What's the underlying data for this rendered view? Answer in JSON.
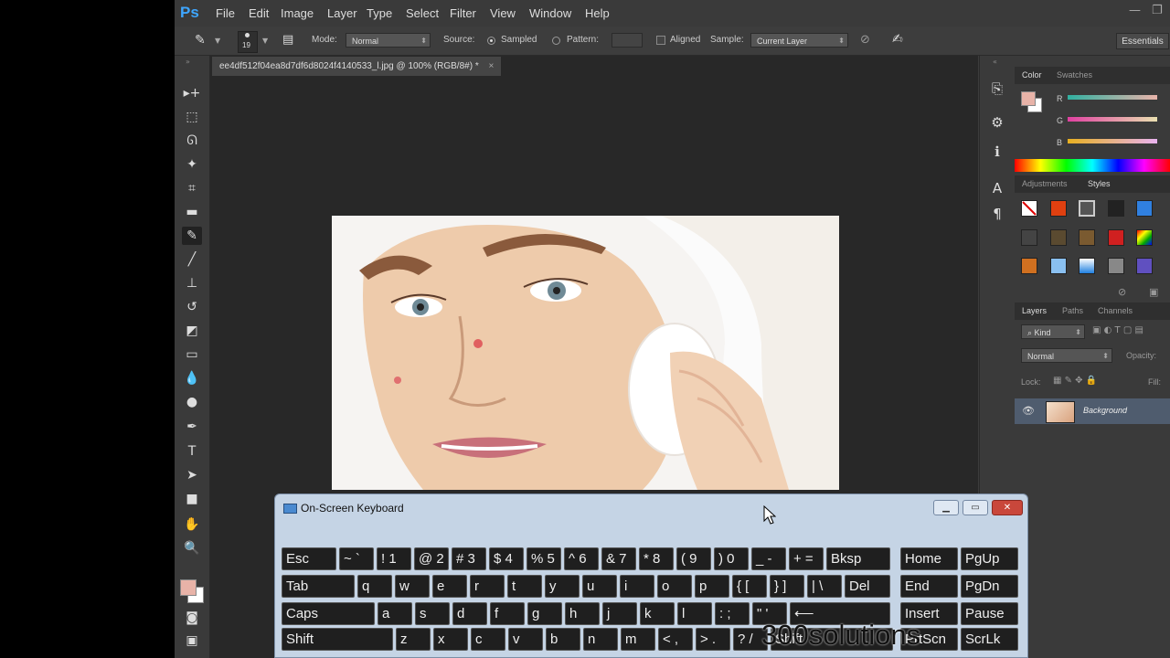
{
  "app": {
    "logo": "Ps"
  },
  "menu": [
    "File",
    "Edit",
    "Image",
    "Layer",
    "Type",
    "Select",
    "Filter",
    "View",
    "Window",
    "Help"
  ],
  "options_bar": {
    "brush_size": "19",
    "mode_label": "Mode:",
    "mode_value": "Normal",
    "source_label": "Source:",
    "sampled": "Sampled",
    "pattern": "Pattern:",
    "aligned": "Aligned",
    "sample_label": "Sample:",
    "sample_value": "Current Layer",
    "workspace": "Essentials"
  },
  "document": {
    "tab_title": "ee4df512f04ea8d7df6d8024f4140533_l.jpg @ 100% (RGB/8#) *",
    "close": "×"
  },
  "color_panel": {
    "tabs": [
      "Color",
      "Swatches"
    ],
    "channels": [
      {
        "label": "R",
        "level": 0.76
      },
      {
        "label": "G",
        "level": 0.63
      },
      {
        "label": "B",
        "level": 0.58
      }
    ],
    "foreground": "#e8b3a8",
    "background": "#ffffff"
  },
  "styles_panel": {
    "tabs": [
      "Adjustments",
      "Styles"
    ]
  },
  "layers_panel": {
    "tabs": [
      "Layers",
      "Paths",
      "Channels"
    ],
    "kind": "Kind",
    "blend": "Normal",
    "opacity_label": "Opacity:",
    "lock_label": "Lock:",
    "fill_label": "Fill:",
    "layer_name": "Background"
  },
  "osk": {
    "title": "On-Screen Keyboard",
    "rows": [
      [
        {
          "l": "Esc",
          "w": 60
        },
        {
          "l": "~ `",
          "w": 38
        },
        {
          "l": "! 1",
          "w": 38
        },
        {
          "l": "@ 2",
          "w": 38
        },
        {
          "l": "# 3",
          "w": 38
        },
        {
          "l": "$ 4",
          "w": 38
        },
        {
          "l": "% 5",
          "w": 38
        },
        {
          "l": "^ 6",
          "w": 38
        },
        {
          "l": "& 7",
          "w": 38
        },
        {
          "l": "* 8",
          "w": 38
        },
        {
          "l": "( 9",
          "w": 38
        },
        {
          "l": ") 0",
          "w": 38
        },
        {
          "l": "_ -",
          "w": 38
        },
        {
          "l": "+ =",
          "w": 38
        },
        {
          "l": "Bksp",
          "w": 70
        }
      ],
      [
        {
          "l": "Tab",
          "w": 80
        },
        {
          "l": "q",
          "w": 38
        },
        {
          "l": "w",
          "w": 38
        },
        {
          "l": "e",
          "w": 38
        },
        {
          "l": "r",
          "w": 38
        },
        {
          "l": "t",
          "w": 38
        },
        {
          "l": "y",
          "w": 38
        },
        {
          "l": "u",
          "w": 38
        },
        {
          "l": "i",
          "w": 38
        },
        {
          "l": "o",
          "w": 38
        },
        {
          "l": "p",
          "w": 38
        },
        {
          "l": "{ [",
          "w": 38
        },
        {
          "l": "} ]",
          "w": 38
        },
        {
          "l": "| \\",
          "w": 38
        },
        {
          "l": "Del",
          "w": 50
        }
      ],
      [
        {
          "l": "Caps",
          "w": 102
        },
        {
          "l": "a",
          "w": 38
        },
        {
          "l": "s",
          "w": 38
        },
        {
          "l": "d",
          "w": 38
        },
        {
          "l": "f",
          "w": 38
        },
        {
          "l": "g",
          "w": 38
        },
        {
          "l": "h",
          "w": 38
        },
        {
          "l": "j",
          "w": 38
        },
        {
          "l": "k",
          "w": 38
        },
        {
          "l": "l",
          "w": 38
        },
        {
          "l": ": ;",
          "w": 38
        },
        {
          "l": "\" '",
          "w": 38
        },
        {
          "l": "⟵",
          "w": 110
        }
      ],
      [
        {
          "l": "Shift",
          "w": 122
        },
        {
          "l": "z",
          "w": 38
        },
        {
          "l": "x",
          "w": 38
        },
        {
          "l": "c",
          "w": 38
        },
        {
          "l": "v",
          "w": 38
        },
        {
          "l": "b",
          "w": 38
        },
        {
          "l": "n",
          "w": 38
        },
        {
          "l": "m",
          "w": 38
        },
        {
          "l": "< ,",
          "w": 38
        },
        {
          "l": "> .",
          "w": 38
        },
        {
          "l": "? /",
          "w": 38
        },
        {
          "l": "Shift",
          "w": 134
        }
      ]
    ],
    "nav": [
      [
        "Home",
        "PgUp"
      ],
      [
        "End",
        "PgDn"
      ],
      [
        "Insert",
        "Pause"
      ],
      [
        "PrtScn",
        "ScrLk"
      ]
    ]
  },
  "watermark": "300solutions"
}
